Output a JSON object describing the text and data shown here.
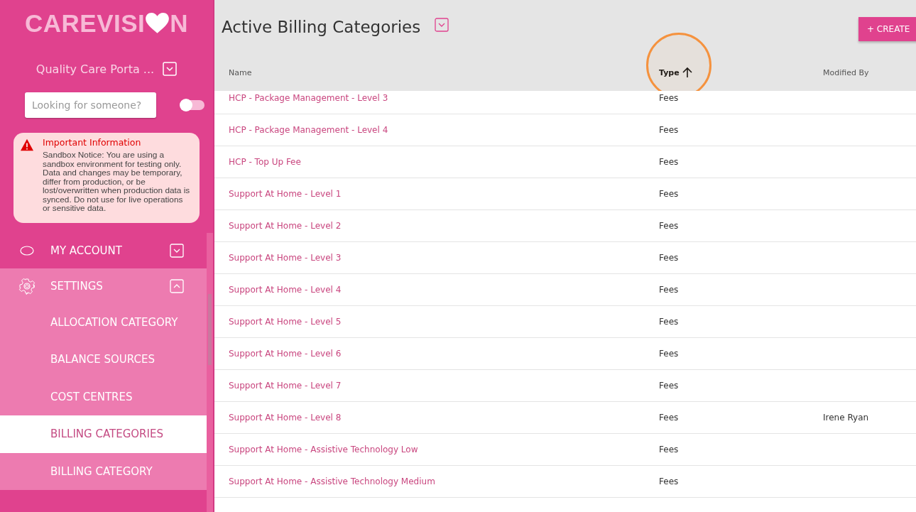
{
  "sidebar": {
    "logo": {
      "start": "CAREVISI",
      "end": "N"
    },
    "organisation": "Quality Care Porta ...",
    "search": {
      "placeholder": "Looking for someone?"
    },
    "toggle": {
      "on": false
    },
    "notice": {
      "title": "Important Information",
      "text": "Sandbox Notice: You are using a sandbox environment for testing only. Data and changes may be temporary, differ from production, or be lost/overwritten when production data is synced. Do not use for live operations or sensitive data."
    },
    "nav": [
      {
        "label": "MY ACCOUNT",
        "kind": "section",
        "expanded": false
      },
      {
        "label": "SETTINGS",
        "kind": "section",
        "expanded": true
      },
      {
        "label": "ALLOCATION CATEGORY",
        "kind": "sub",
        "selected": false
      },
      {
        "label": "BALANCE SOURCES",
        "kind": "sub",
        "selected": false
      },
      {
        "label": "COST CENTRES",
        "kind": "sub",
        "selected": false
      },
      {
        "label": "BILLING CATEGORIES",
        "kind": "sub",
        "selected": true
      },
      {
        "label": "BILLING CATEGORY",
        "kind": "sub",
        "selected": false
      }
    ]
  },
  "page": {
    "title": "Active Billing Categories",
    "create_button": "+ CREATE"
  },
  "table": {
    "columns": [
      {
        "label": "Name",
        "sorted": false
      },
      {
        "label": "Type",
        "sorted": true
      },
      {
        "label": "Modified By",
        "sorted": false
      }
    ],
    "rows": [
      [
        "HCP - Package Management - Level 3",
        "Fees",
        ""
      ],
      [
        "HCP - Package Management - Level 4",
        "Fees",
        ""
      ],
      [
        "HCP - Top Up Fee",
        "Fees",
        ""
      ],
      [
        "Support At Home - Level 1",
        "Fees",
        ""
      ],
      [
        "Support At Home - Level 2",
        "Fees",
        ""
      ],
      [
        "Support At Home - Level 3",
        "Fees",
        ""
      ],
      [
        "Support At Home - Level 4",
        "Fees",
        ""
      ],
      [
        "Support At Home - Level 5",
        "Fees",
        ""
      ],
      [
        "Support At Home - Level 6",
        "Fees",
        ""
      ],
      [
        "Support At Home - Level 7",
        "Fees",
        ""
      ],
      [
        "Support At Home - Level 8",
        "Fees",
        "Irene Ryan"
      ],
      [
        "Support At Home - Assistive Technology Low",
        "Fees",
        ""
      ],
      [
        "Support At Home - Assistive Technology Medium",
        "Fees",
        ""
      ]
    ]
  }
}
